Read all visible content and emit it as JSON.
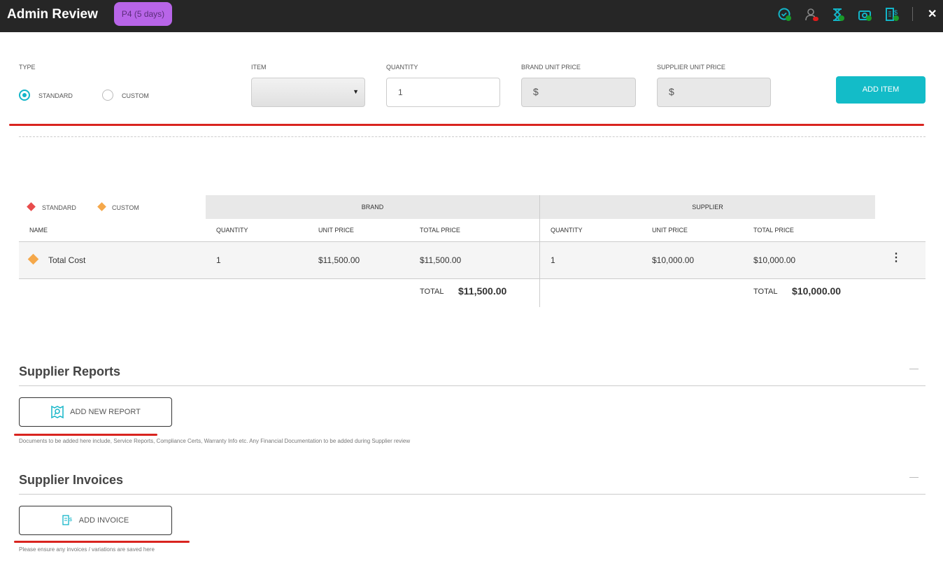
{
  "header": {
    "title": "Admin Review",
    "priority_badge": "P4 (5 days)",
    "icons": [
      "check-circle-icon",
      "user-icon",
      "hourglass-icon",
      "camera-icon",
      "invoice-icon"
    ],
    "close": "✕"
  },
  "form": {
    "type_label": "TYPE",
    "standard": "STANDARD",
    "custom": "CUSTOM",
    "selected_type": "standard",
    "item_label": "ITEM",
    "item_value": "",
    "quantity_label": "QUANTITY",
    "quantity_value": "1",
    "brand_price_label": "BRAND UNIT PRICE",
    "brand_price_prefix": "$",
    "supplier_price_label": "SUPPLIER UNIT PRICE",
    "supplier_price_prefix": "$",
    "add_item": "ADD ITEM"
  },
  "table": {
    "legend": {
      "standard": "STANDARD",
      "custom": "CUSTOM"
    },
    "brand": "BRAND",
    "supplier": "SUPPLIER",
    "columns": {
      "name": "NAME",
      "quantity": "QUANTITY",
      "unit_price": "UNIT PRICE",
      "total_price": "TOTAL PRICE"
    },
    "rows": [
      {
        "name": "Total Cost",
        "brand_qty": "1",
        "brand_unit": "$11,500.00",
        "brand_total": "$11,500.00",
        "supplier_qty": "1",
        "supplier_unit": "$10,000.00",
        "supplier_total": "$10,000.00"
      }
    ],
    "total_label": "TOTAL",
    "brand_total": "$11,500.00",
    "supplier_total": "$10,000.00",
    "colors": {
      "standard": "#e84c4c",
      "custom": "#f5a84a"
    }
  },
  "reports": {
    "title": "Supplier Reports",
    "button": "ADD NEW REPORT",
    "note": "Documents to be added here include, Service Reports, Compliance Certs, Warranty Info etc. Any Financial Documentation to be added during Supplier review"
  },
  "invoices": {
    "title": "Supplier Invoices",
    "button": "ADD INVOICE",
    "note": "Please ensure any invoices / variations are saved here"
  }
}
